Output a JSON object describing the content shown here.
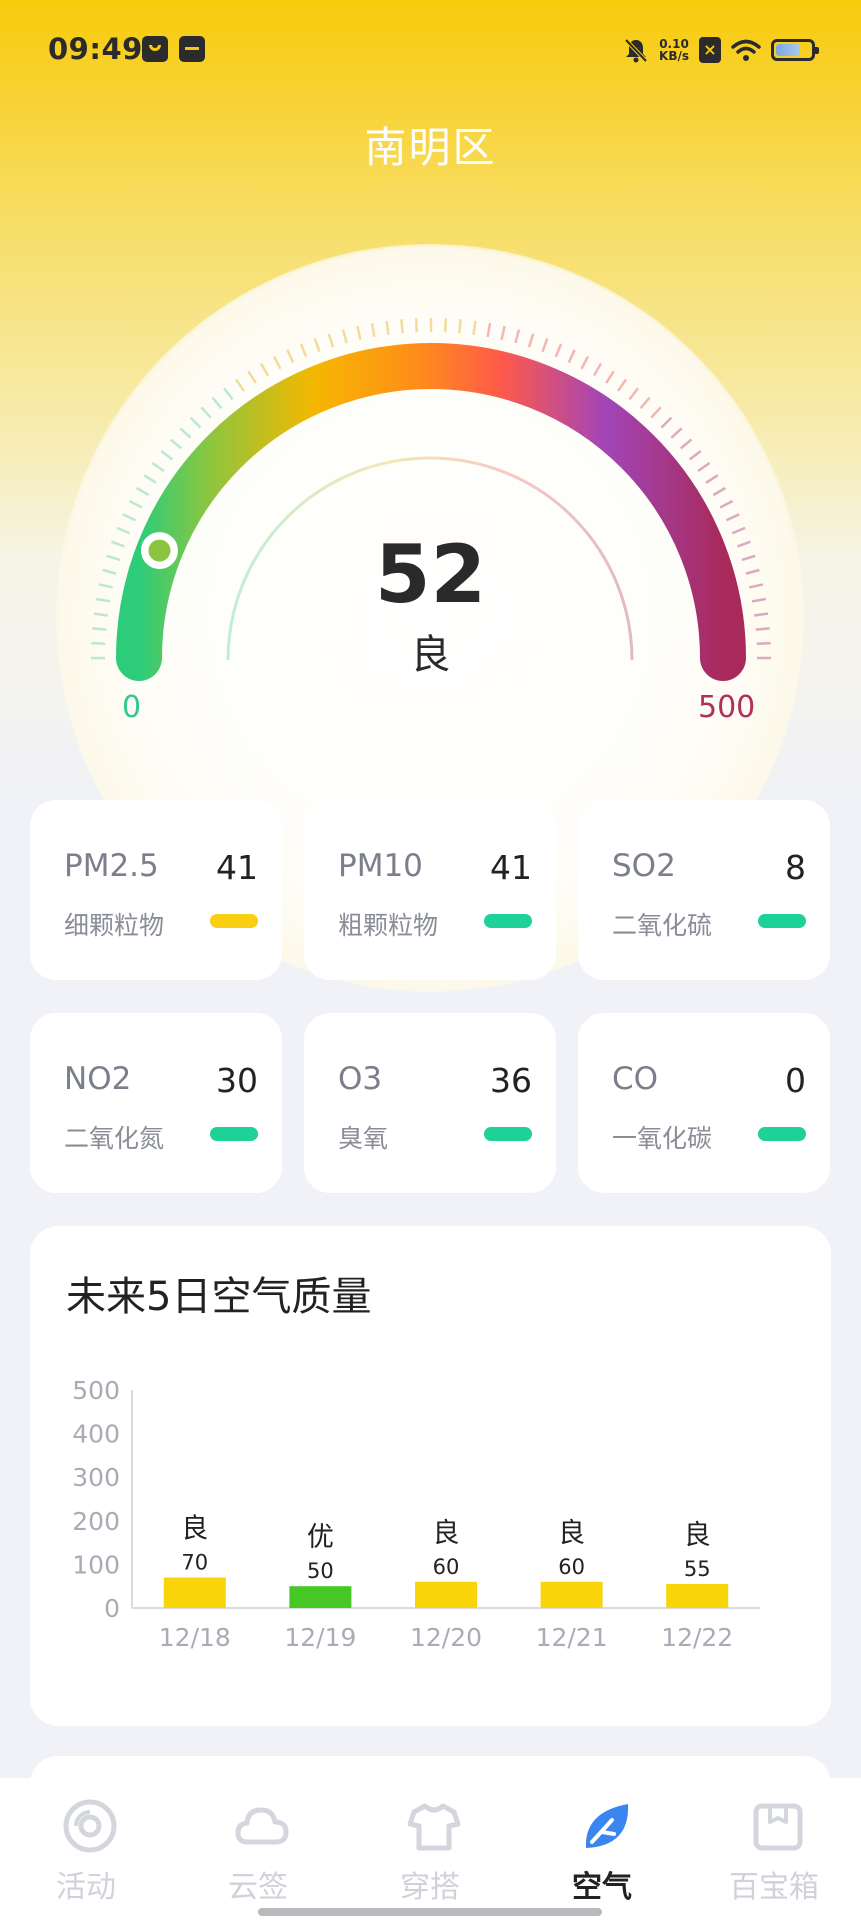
{
  "status_bar": {
    "time": "09:49",
    "net_speed_value": "0.10",
    "net_speed_unit": "KB/s",
    "icons": [
      "app-notification-icon",
      "calendar-app-icon",
      "mute-bell-icon",
      "no-sim-icon",
      "wifi-icon",
      "battery-icon"
    ]
  },
  "header": {
    "district": "南明区"
  },
  "gauge": {
    "aqi": "52",
    "level": "良",
    "min": "0",
    "max": "500",
    "value_fraction": 0.104,
    "colors": [
      "#2dcc7a",
      "#8cc63f",
      "#f5b700",
      "#ff8c1a",
      "#ff5a4a",
      "#a145b8",
      "#a82a5a"
    ]
  },
  "pollutants": [
    {
      "name": "PM2.5",
      "value": "41",
      "desc": "细颗粒物",
      "color": "#f8cf12"
    },
    {
      "name": "PM10",
      "value": "41",
      "desc": "粗颗粒物",
      "color": "#1dd199"
    },
    {
      "name": "SO2",
      "value": "8",
      "desc": "二氧化硫",
      "color": "#1dd199"
    },
    {
      "name": "NO2",
      "value": "30",
      "desc": "二氧化氮",
      "color": "#1dd199"
    },
    {
      "name": "O3",
      "value": "36",
      "desc": "臭氧",
      "color": "#1dd199"
    },
    {
      "name": "CO",
      "value": "0",
      "desc": "一氧化碳",
      "color": "#1dd199"
    }
  ],
  "forecast": {
    "title": "未来5日空气质量"
  },
  "chart_data": {
    "type": "bar",
    "title": "未来5日空气质量",
    "categories": [
      "12/18",
      "12/19",
      "12/20",
      "12/21",
      "12/22"
    ],
    "values": [
      70,
      50,
      60,
      60,
      55
    ],
    "levels": [
      "良",
      "优",
      "良",
      "良",
      "良"
    ],
    "colors": [
      "#f8d409",
      "#46c726",
      "#f8d409",
      "#f8d409",
      "#f8d409"
    ],
    "y_ticks": [
      "0",
      "100",
      "200",
      "300",
      "400",
      "500"
    ],
    "ylim": [
      0,
      500
    ],
    "grid": false,
    "legend": "none"
  },
  "tabbar": {
    "tabs": [
      {
        "label": "活动",
        "icon": "activity-disc-icon",
        "active": false
      },
      {
        "label": "云签",
        "icon": "cloud-icon",
        "active": false
      },
      {
        "label": "穿搭",
        "icon": "tshirt-icon",
        "active": false
      },
      {
        "label": "空气",
        "icon": "leaf-icon",
        "active": true
      },
      {
        "label": "百宝箱",
        "icon": "treasure-box-icon",
        "active": false
      }
    ],
    "active_color": "#3a86f0"
  }
}
